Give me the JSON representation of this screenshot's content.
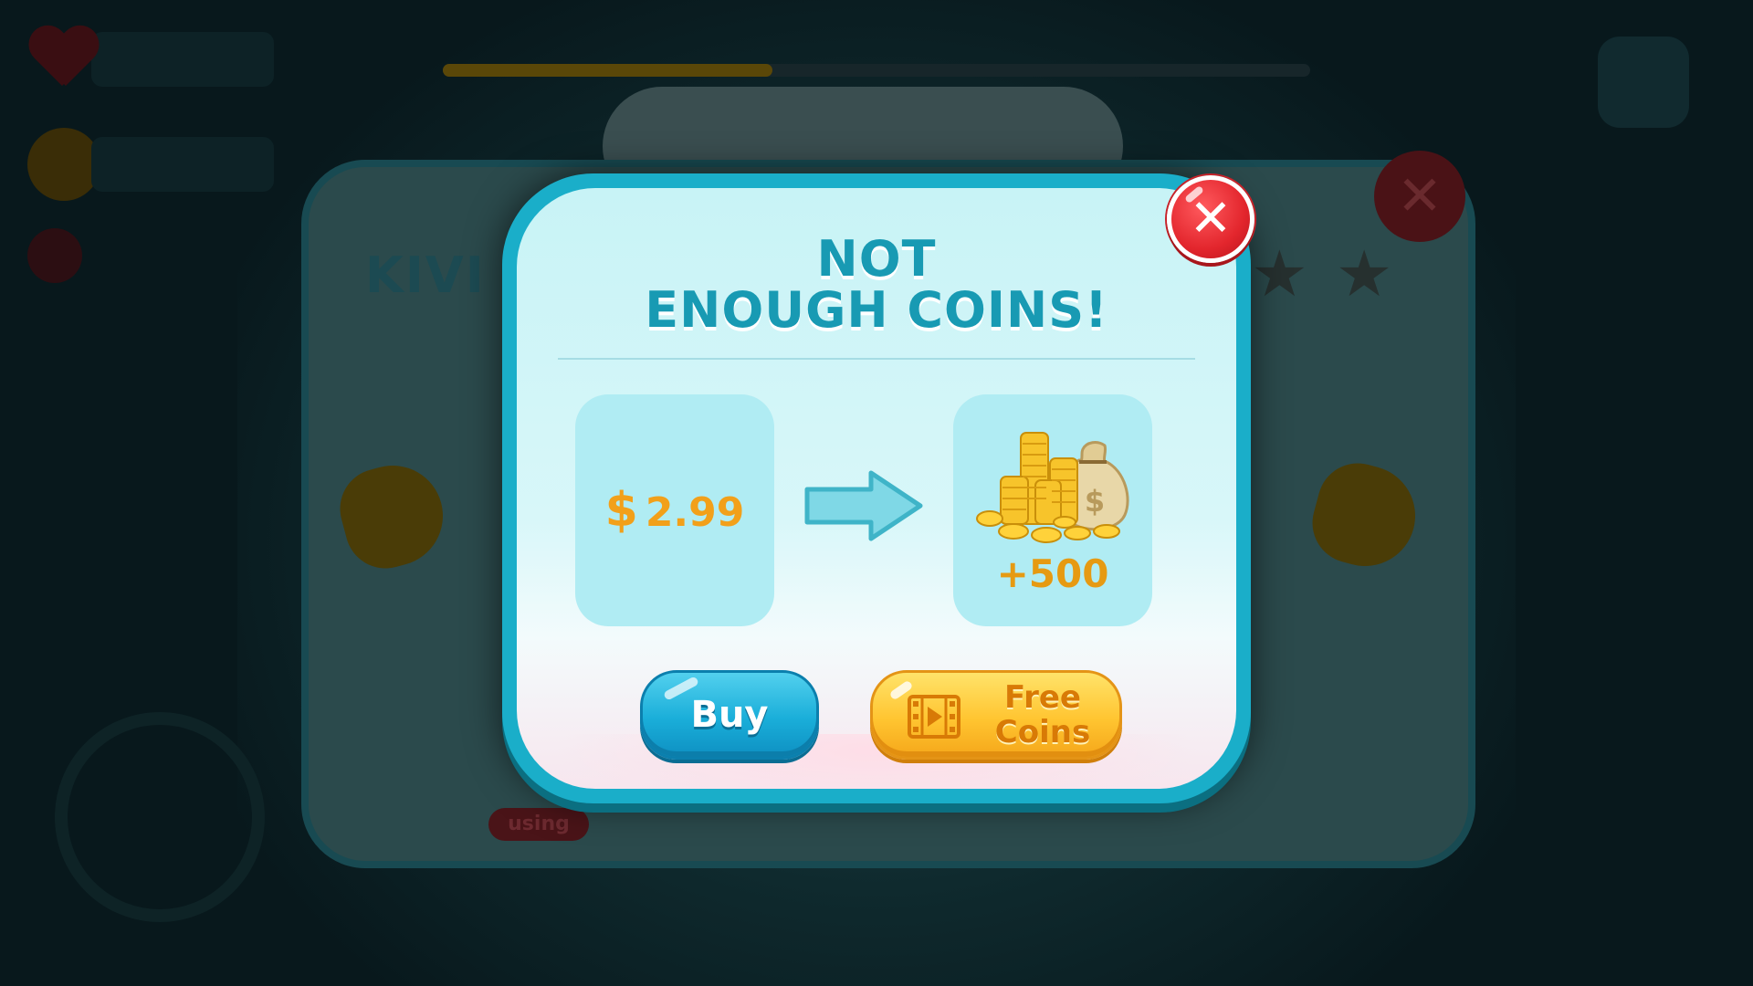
{
  "background": {
    "panel_title": "KIVI",
    "tag_label": "using",
    "progress_fraction": 0.38,
    "stars_count": 2
  },
  "dialog": {
    "title_line1": "NOT",
    "title_line2": "ENOUGH COINS!",
    "price_currency": "$",
    "price_value": "2.99",
    "reward_amount": "+500",
    "buy_label": "Buy",
    "free_coins_label": "Free Coins",
    "close_label": "✕"
  },
  "icons": {
    "arrow": "arrow-right-icon",
    "coins": "coin-stack-icon",
    "money_bag": "money-bag-icon",
    "film": "film-play-icon",
    "close": "close-icon"
  },
  "colors": {
    "dialog_border": "#1aaec9",
    "title": "#189ab3",
    "price": "#f2a01a",
    "buy_button": "#1aaed9",
    "free_button": "#ffc531",
    "close_button": "#e3262d"
  }
}
